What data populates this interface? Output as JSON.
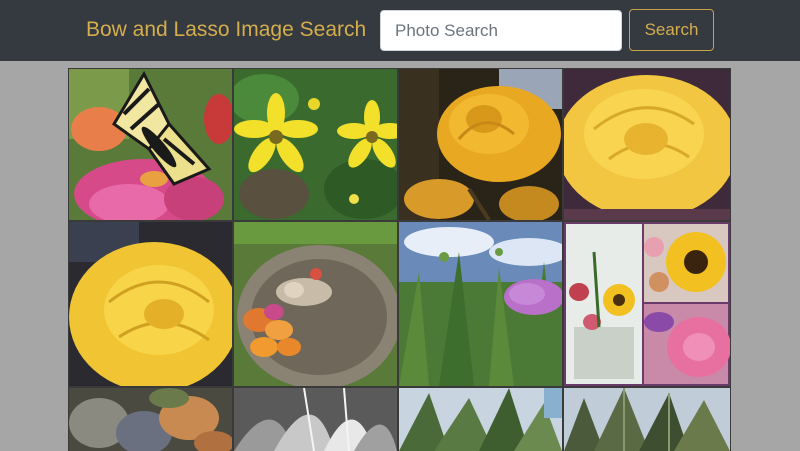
{
  "navbar": {
    "brand": "Bow and Lasso Image Search",
    "search": {
      "placeholder": "Photo Search",
      "value": ""
    },
    "search_button_label": "Search"
  },
  "gallery": {
    "tiles": [
      {
        "subject": "swallowtail-butterfly-on-zinnia"
      },
      {
        "subject": "yellow-daisies"
      },
      {
        "subject": "yellow-rose-close"
      },
      {
        "subject": "yellow-rose-large"
      },
      {
        "subject": "yellow-rose"
      },
      {
        "subject": "flowers-in-birdbath"
      },
      {
        "subject": "thistle-sky"
      },
      {
        "subject": "flower-collage"
      },
      {
        "subject": "dried-hydrangea"
      },
      {
        "subject": "black-white-petals"
      },
      {
        "subject": "green-plant-sky"
      },
      {
        "subject": "thistle-leaves"
      }
    ]
  }
}
